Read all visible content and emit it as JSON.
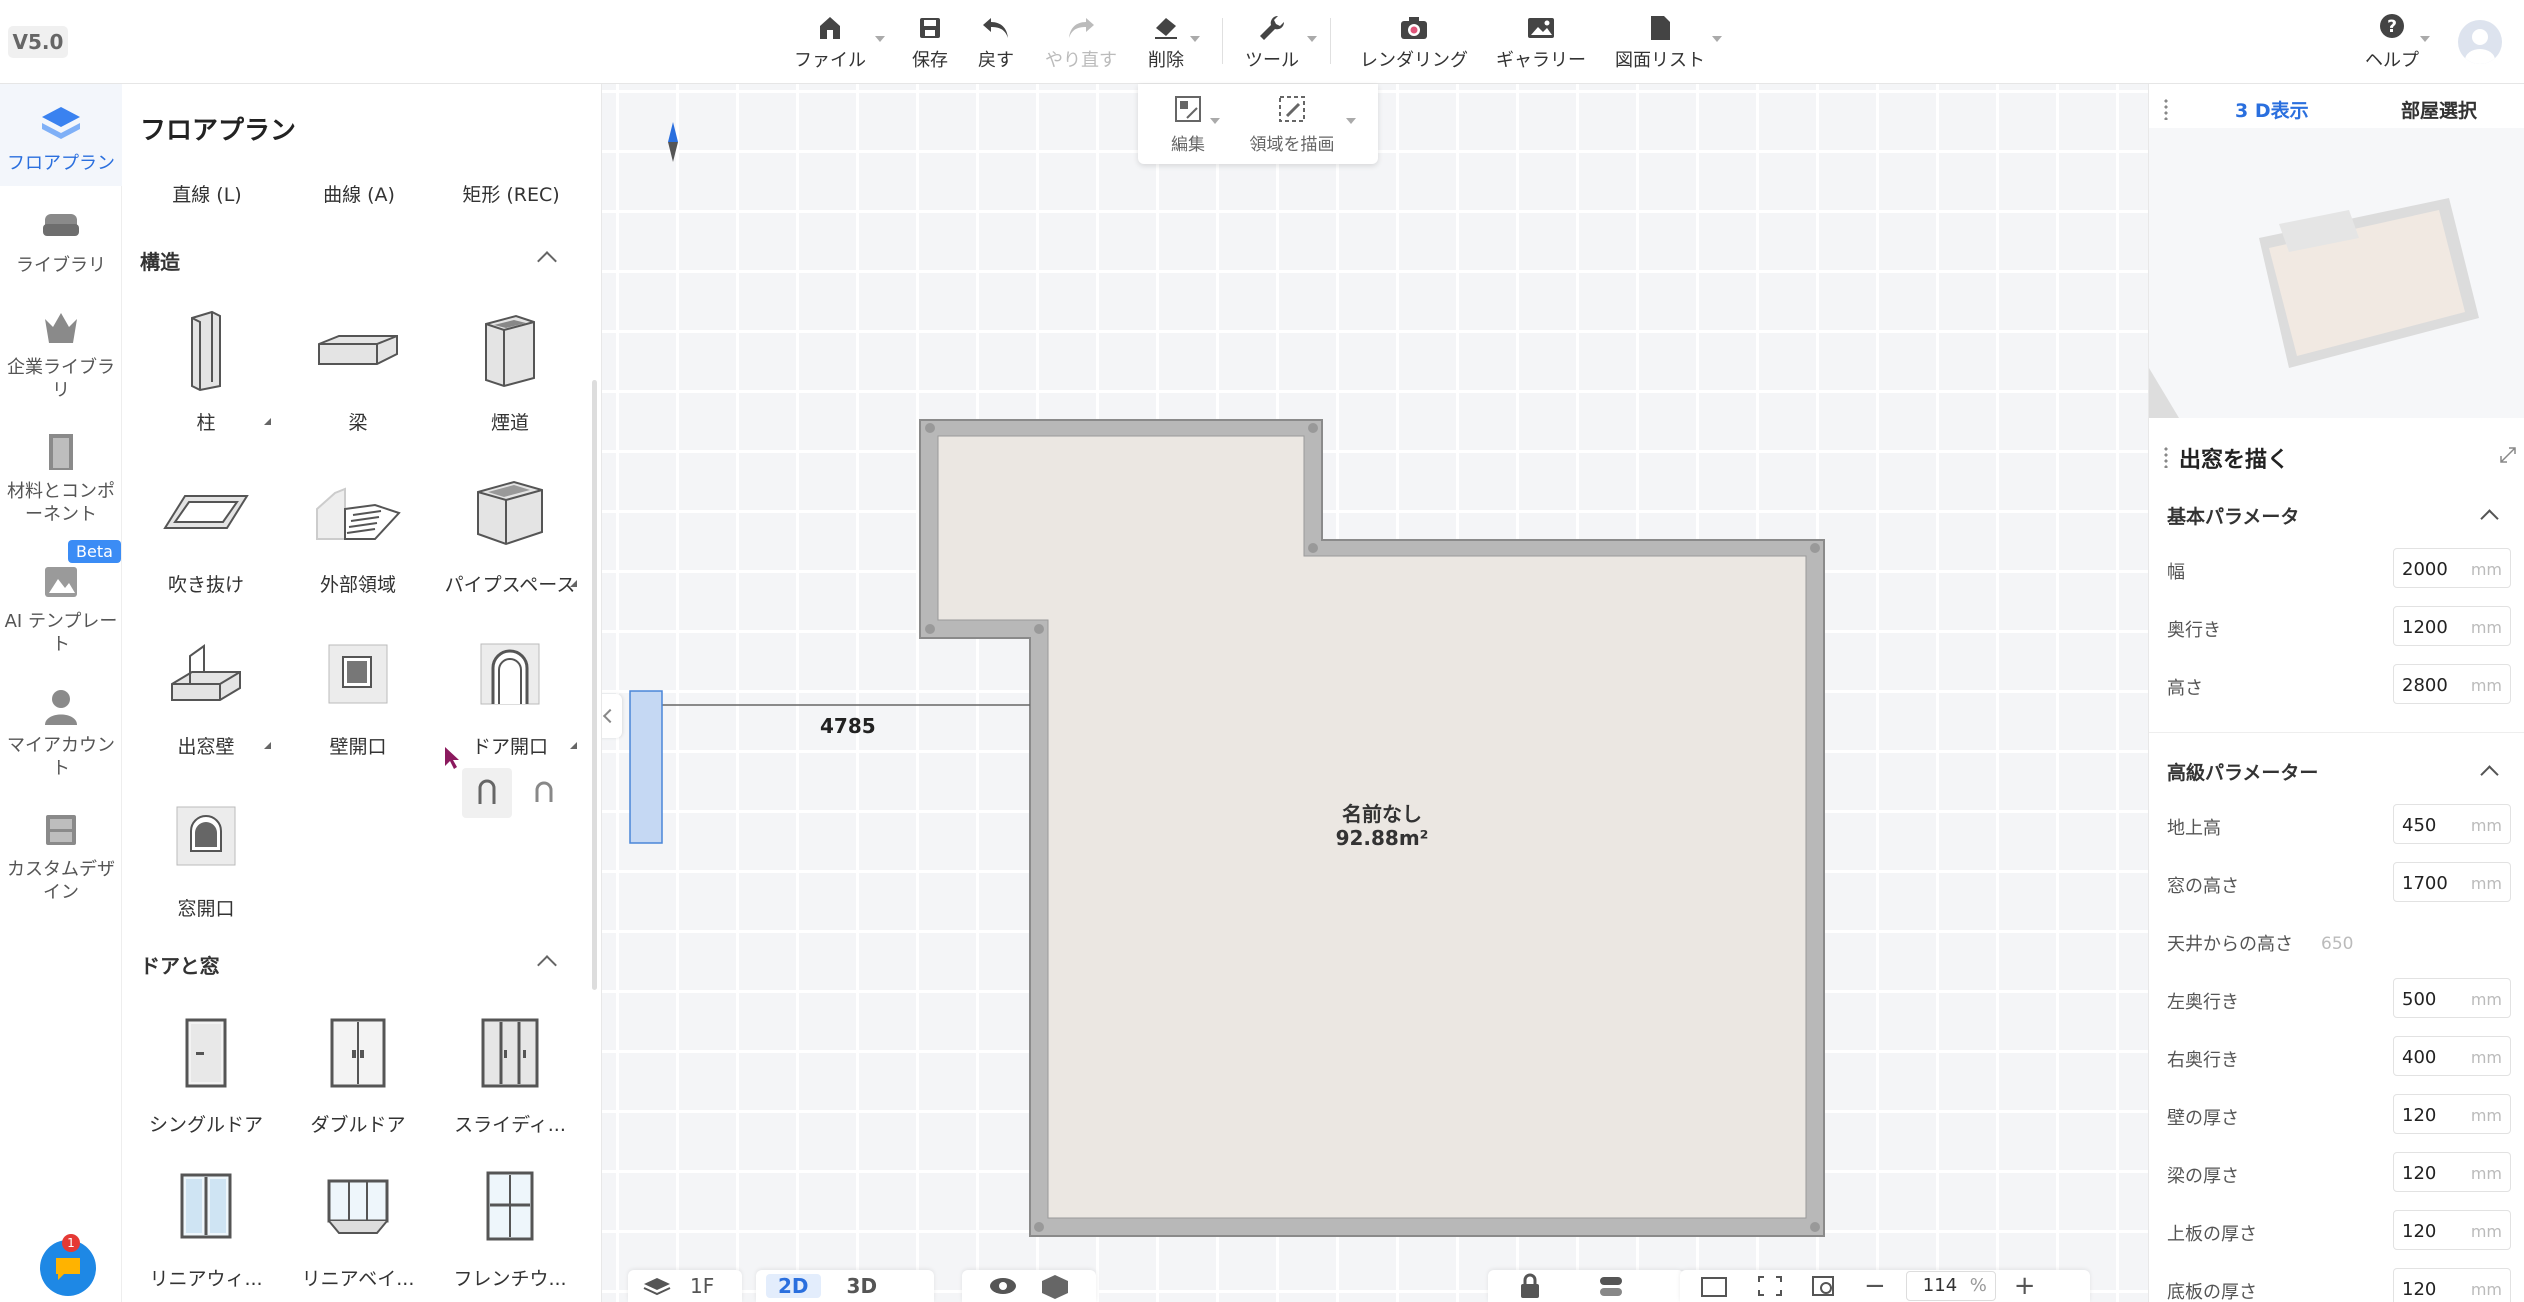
{
  "app": {
    "version": "V5.0"
  },
  "toolbar": {
    "file": "ファイル",
    "save": "保存",
    "undo": "戻す",
    "redo": "やり直す",
    "delete": "削除",
    "tools": "ツール",
    "rendering": "レンダリング",
    "gallery": "ギャラリー",
    "drawing_list": "図面リスト",
    "help": "ヘルプ"
  },
  "nav": {
    "items": [
      {
        "label": "フロアプラン"
      },
      {
        "label": "ライブラリ"
      },
      {
        "label": "企業ライブラリ"
      },
      {
        "label": "材料とコンポーネント"
      },
      {
        "label": "AI テンプレート"
      },
      {
        "label": "マイアカウント"
      },
      {
        "label": "カスタムデザイン"
      }
    ],
    "beta": "Beta",
    "chat_badge": "1"
  },
  "panel": {
    "title": "フロアプラン",
    "draw_tools": [
      "直線 (L)",
      "曲線 (A)",
      "矩形 (REC)"
    ],
    "structure_title": "構造",
    "structure_items": [
      "柱",
      "梁",
      "煙道",
      "吹き抜け",
      "外部領域",
      "パイプスペース",
      "出窓壁",
      "壁開口",
      "ドア開口",
      "窓開口"
    ],
    "doors_title": "ドアと窓",
    "door_items": [
      "シングルドア",
      "ダブルドア",
      "スライディ...",
      "リニアウィ...",
      "リニアベイ...",
      "フレンチウ..."
    ]
  },
  "canvas_toolbar": {
    "edit": "編集",
    "draw_area": "領域を描画"
  },
  "canvas": {
    "dimension": "4785",
    "room_name": "名前なし",
    "room_area": "92.88m²"
  },
  "bottom": {
    "floor": "1F",
    "view2d": "2D",
    "view3d": "3D",
    "zoom": "114",
    "zoom_unit": "%"
  },
  "right_panel": {
    "tab_3d": "3 D表示",
    "tab_room": "部屋選択",
    "title": "出窓を描く",
    "basic_title": "基本パラメータ",
    "basic": [
      {
        "label": "幅",
        "value": "2000",
        "unit": "mm"
      },
      {
        "label": "奥行き",
        "value": "1200",
        "unit": "mm"
      },
      {
        "label": "高さ",
        "value": "2800",
        "unit": "mm"
      }
    ],
    "advanced_title": "高級パラメーター",
    "advanced": [
      {
        "label": "地上高",
        "value": "450",
        "unit": "mm"
      },
      {
        "label": "窓の高さ",
        "value": "1700",
        "unit": "mm"
      },
      {
        "label": "天井からの高さ",
        "value": "650",
        "unit": ""
      },
      {
        "label": "左奥行き",
        "value": "500",
        "unit": "mm"
      },
      {
        "label": "右奥行き",
        "value": "400",
        "unit": "mm"
      },
      {
        "label": "壁の厚さ",
        "value": "120",
        "unit": "mm"
      },
      {
        "label": "梁の厚さ",
        "value": "120",
        "unit": "mm"
      },
      {
        "label": "上板の厚さ",
        "value": "120",
        "unit": "mm"
      },
      {
        "label": "底板の厚さ",
        "value": "120",
        "unit": "mm"
      }
    ]
  },
  "colors": {
    "accent": "#2a6fde",
    "wall": "#b8b8b8",
    "floor": "#ebe7e2",
    "selection": "#c5d8f3"
  }
}
